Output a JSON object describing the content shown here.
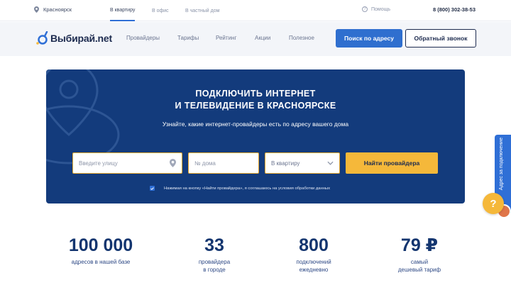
{
  "topbar": {
    "city": "Красноярск",
    "segments": [
      "В квартиру",
      "В офис",
      "В частный дом"
    ],
    "help": "Помощь",
    "phone": "8 (800) 302-38-53"
  },
  "nav": {
    "logo": "Выбирай.net",
    "items": [
      "Провайдеры",
      "Тарифы",
      "Рейтинг",
      "Акции",
      "Полезное"
    ],
    "search_button": "Поиск по адресу",
    "callback_button": "Обратный звонок"
  },
  "hero": {
    "title_line1": "ПОДКЛЮЧИТЬ ИНТЕРНЕТ",
    "title_line2": "И ТЕЛЕВИДЕНИЕ В КРАСНОЯРСКЕ",
    "subtitle": "Узнайте, какие интернет-провайдеры есть по адресу вашего дома",
    "street_placeholder": "Введите улицу",
    "house_placeholder": "№ дома",
    "type_select": "В квартиру",
    "find_button": "Найти провайдера",
    "consent": "Нажимая на кнопку «Найти провайдера», я соглашаюсь на условия обработки данных"
  },
  "side": {
    "tab_label": "Адрес за подключение",
    "chat_icon": "?"
  },
  "stats": [
    {
      "number": "100 000",
      "label1": "адресов в нашей базе",
      "label2": ""
    },
    {
      "number": "33",
      "label1": "провайдера",
      "label2": "в городе"
    },
    {
      "number": "800",
      "label1": "подключений",
      "label2": "ежедневно"
    },
    {
      "number": "79 ₽",
      "label1": "самый",
      "label2": "дешевый тариф"
    }
  ],
  "colors": {
    "accent": "#2f6fcf",
    "hero_bg": "#133b7c",
    "cta": "#f5b83a"
  }
}
